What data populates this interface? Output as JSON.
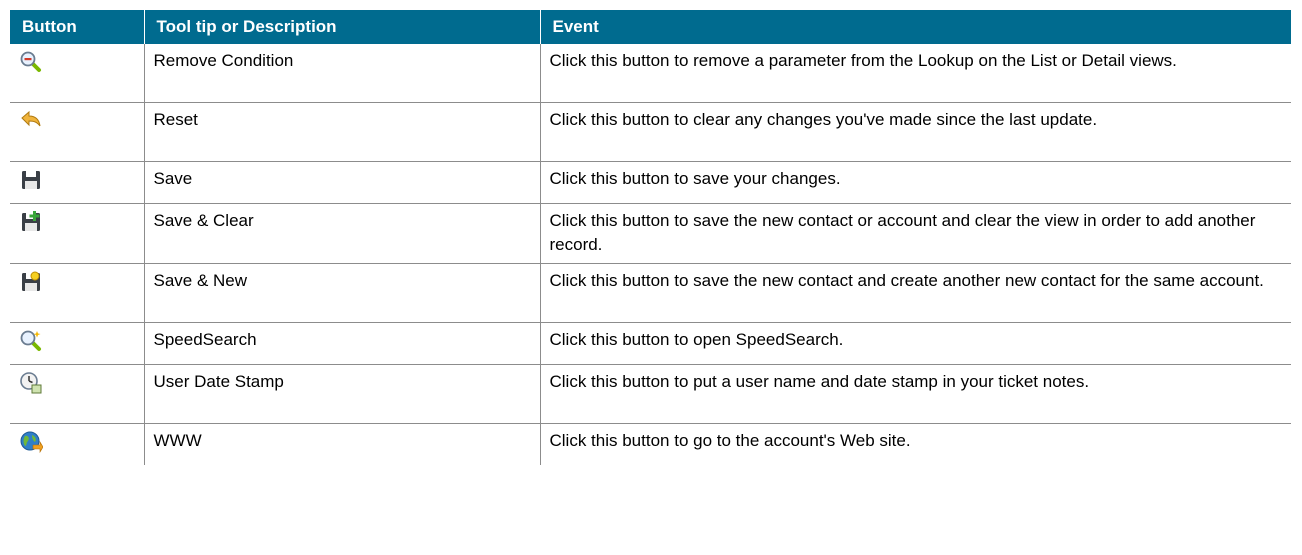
{
  "table": {
    "headers": [
      "Button",
      "Tool tip or Description",
      "Event"
    ],
    "rows": [
      {
        "icon": "remove-condition-magnifier-icon",
        "tooltip": "Remove Condition",
        "event": "Click this button to remove a parameter from the Lookup on the List or Detail views."
      },
      {
        "icon": "reset-arrow-icon",
        "tooltip": "Reset",
        "event": "Click this button to clear any changes you've made since the last update."
      },
      {
        "icon": "save-floppy-icon",
        "tooltip": "Save",
        "event": "Click this button to save your changes."
      },
      {
        "icon": "save-clear-floppy-icon",
        "tooltip": "Save & Clear",
        "event": "Click this button to save the new contact or account and clear the view in order to add another record."
      },
      {
        "icon": "save-new-floppy-icon",
        "tooltip": "Save & New",
        "event": "Click this button to save the new contact and create another new contact for the same account."
      },
      {
        "icon": "speedsearch-magnifier-icon",
        "tooltip": "SpeedSearch",
        "event": "Click this button to open SpeedSearch."
      },
      {
        "icon": "user-date-stamp-clock-icon",
        "tooltip": "User Date Stamp",
        "event": "Click this button to put a user name and date stamp in your ticket notes."
      },
      {
        "icon": "www-globe-icon",
        "tooltip": "WWW",
        "event": "Click this button to go to the account's Web site."
      }
    ]
  },
  "colors": {
    "header_bg": "#006b8f",
    "header_text": "#ffffff",
    "grid_line": "#8c8c8c"
  }
}
